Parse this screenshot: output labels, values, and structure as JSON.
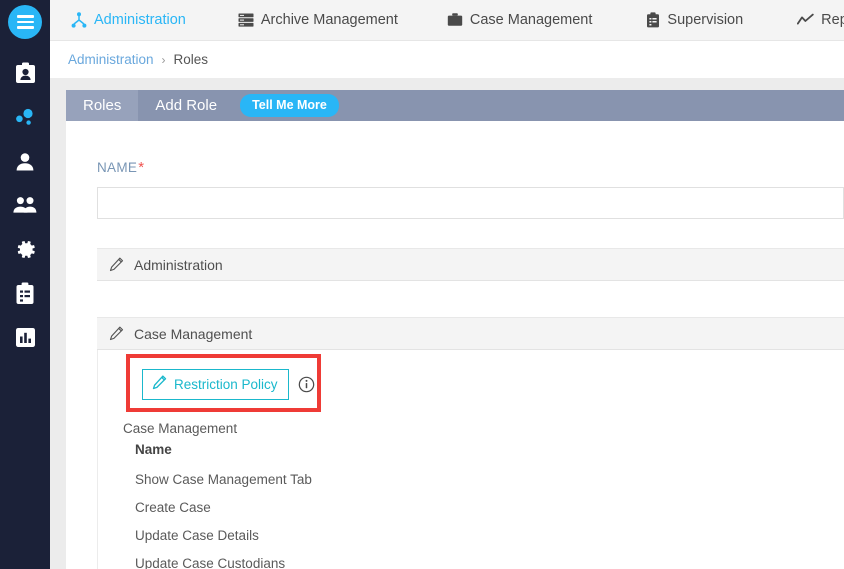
{
  "colors": {
    "rail_bg": "#1b2138",
    "accent_blue": "#29b6f6",
    "tab_bar": "#8894af",
    "tab_inactive": "#97a2bb",
    "teal": "#1ab8cc",
    "highlight_red": "#ef3b36",
    "required_red": "#ef5350",
    "breadcrumb_link": "#6aa8dd",
    "label_blue": "#7996b5",
    "section_bg": "#f4f4f4",
    "page_bg": "#ececec"
  },
  "rail": {
    "menu_button": "hamburger-menu-icon",
    "items": [
      {
        "icon": "id-badge-icon",
        "name": "rail-item-id-badge"
      },
      {
        "icon": "network-nodes-icon",
        "name": "rail-item-network"
      },
      {
        "icon": "user-icon",
        "name": "rail-item-user"
      },
      {
        "icon": "users-group-icon",
        "name": "rail-item-users-group"
      },
      {
        "icon": "gear-icon",
        "name": "rail-item-settings"
      },
      {
        "icon": "clipboard-icon",
        "name": "rail-item-clipboard"
      },
      {
        "icon": "bar-chart-icon",
        "name": "rail-item-reports"
      }
    ]
  },
  "top_nav": {
    "items": [
      {
        "label": "Administration",
        "icon": "sitemap-icon",
        "active": true
      },
      {
        "label": "Archive Management",
        "icon": "server-stack-icon",
        "active": false
      },
      {
        "label": "Case Management",
        "icon": "briefcase-icon",
        "active": false
      },
      {
        "label": "Supervision",
        "icon": "clipboard-icon",
        "active": false
      },
      {
        "label": "Reports",
        "icon": "chart-line-icon",
        "active": false
      }
    ]
  },
  "breadcrumb": {
    "root": "Administration",
    "separator": "›",
    "current": "Roles"
  },
  "tabs": {
    "items": [
      {
        "label": "Roles",
        "active": false
      },
      {
        "label": "Add Role",
        "active": true
      }
    ],
    "tell_me_more": "Tell Me More"
  },
  "form": {
    "name_label": "NAME",
    "name_required_marker": "*",
    "name_value": "",
    "name_placeholder": ""
  },
  "sections": [
    {
      "title": "Administration",
      "icon": "pencil-icon",
      "expanded": false
    },
    {
      "title": "Case Management",
      "icon": "pencil-icon",
      "expanded": true
    }
  ],
  "case_management": {
    "restriction_policy_button": "Restriction Policy",
    "restriction_policy_icon": "pencil-icon",
    "info_icon": "info-circle-icon",
    "group_title": "Case Management",
    "column_header": "Name",
    "permissions": [
      "Show Case Management Tab",
      "Create Case",
      "Update Case Details",
      "Update Case Custodians"
    ]
  }
}
